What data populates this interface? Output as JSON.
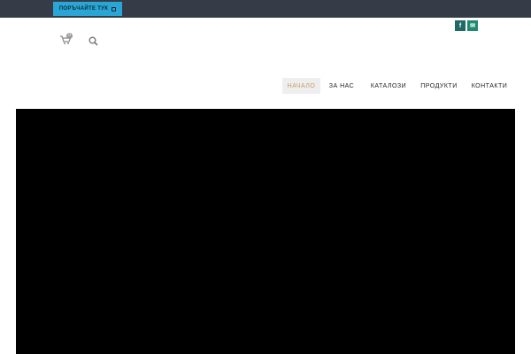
{
  "topbar": {
    "order_button_label": "ПОРЪЧАЙТЕ ТУК"
  },
  "header": {
    "cart_count": "0",
    "social": [
      {
        "name": "facebook",
        "glyph": "f"
      },
      {
        "name": "email",
        "glyph": "✉"
      }
    ]
  },
  "nav": {
    "items": [
      {
        "label": "НАЧАЛО",
        "active": true
      },
      {
        "label": "ЗА НАС",
        "active": false
      },
      {
        "label": "КАТАЛОЗИ",
        "active": false
      },
      {
        "label": "ПРОДУКТИ",
        "active": false
      },
      {
        "label": "КОНТАКТИ",
        "active": false
      }
    ]
  },
  "colors": {
    "topbar": "#353b47",
    "accent": "#2aa6d6",
    "nav_active_text": "#c99a6a",
    "hero": "#000000"
  }
}
